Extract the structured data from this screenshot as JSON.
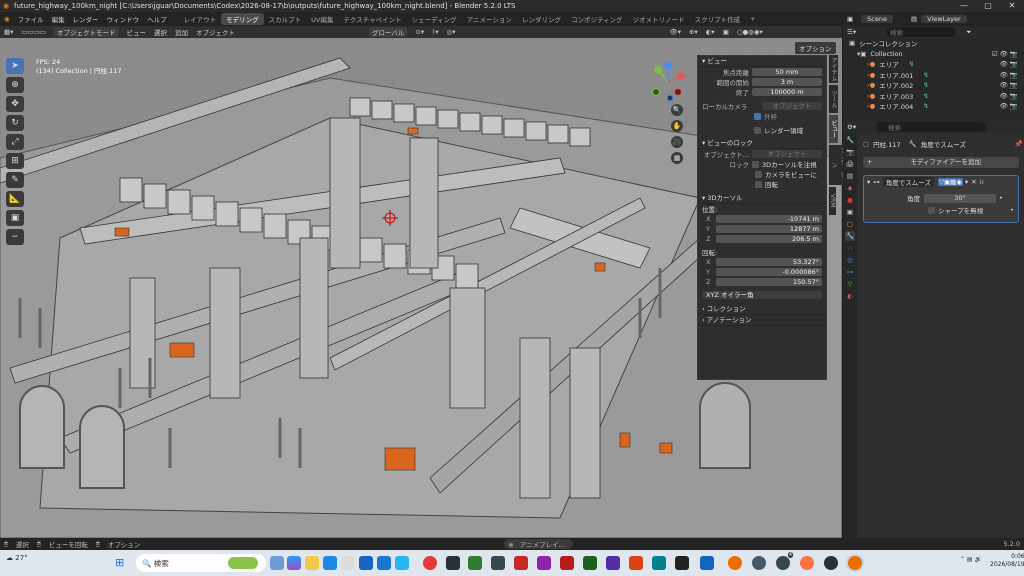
{
  "window": {
    "title": "future_highway_100km_night [C:\\Users\\jguar\\Documents\\Codex\\2026-08-17\\b\\outputs\\future_highway_100km_night.blend] - Blender 5.2.0 LTS"
  },
  "menu": {
    "items": [
      "ファイル",
      "編集",
      "レンダー",
      "ウィンドウ",
      "ヘルプ"
    ]
  },
  "workspaces": [
    "レイアウト",
    "モデリング",
    "スカルプト",
    "UV編集",
    "テクスチャペイント",
    "シェーディング",
    "アニメーション",
    "レンダリング",
    "コンポジティング",
    "ジオメトリノード",
    "スクリプト作成"
  ],
  "active_workspace": "モデリング",
  "scene": {
    "label": "Scene",
    "view_layer": "ViewLayer"
  },
  "viewport_header": {
    "mode": "オブジェクトモード",
    "menus": [
      "ビュー",
      "選択",
      "追加",
      "オブジェクト"
    ],
    "transform": "グローバル",
    "options": "オプション"
  },
  "stats": {
    "fps": "FPS: 24",
    "info": "(134) Collection | 円柱.117"
  },
  "npanel": {
    "view_title": "ビュー",
    "focal_label": "焦点距離",
    "focal_value": "50 mm",
    "clip_start_label": "範囲の開始",
    "clip_start_value": "3 m",
    "clip_end_label": "終了",
    "clip_end_value": "100000 m",
    "local_camera_label": "ローカルカメラ",
    "local_camera_placeholder": "オブジェクト",
    "outline_label": "外枠",
    "render_region_label": "レンダー領域",
    "view_lock_title": "ビューのロック",
    "lock_object_label": "オブジェクト...",
    "lock_object_placeholder": "オブジェクト",
    "lock_label": "ロック",
    "lock_cursor": "3Dカーソルを注視",
    "lock_camera": "カメラをビューに",
    "lock_rotation": "回転",
    "cursor_title": "3Dカーソル",
    "location_label": "位置:",
    "loc": [
      {
        "axis": "X",
        "value": "-10741 m"
      },
      {
        "axis": "Y",
        "value": "12877 m"
      },
      {
        "axis": "Z",
        "value": "206.5 m"
      }
    ],
    "rotation_label": "回転:",
    "rot": [
      {
        "axis": "X",
        "value": "53.327°"
      },
      {
        "axis": "Y",
        "value": "-0.000086°"
      },
      {
        "axis": "Z",
        "value": "150.57°"
      }
    ],
    "rotation_mode": "XYZ オイラー角",
    "collection_title": "コレクション",
    "annotation_title": "アノテーション",
    "tabs": [
      "アイテム",
      "ツール",
      "ビュー",
      "アノテーション",
      "VRM"
    ],
    "active_tab": "ビュー"
  },
  "outliner": {
    "title": "シーンコレクション",
    "collection": "Collection",
    "items": [
      "エリア",
      "エリア.001",
      "エリア.002",
      "エリア.003",
      "エリア.004"
    ],
    "search_placeholder": "検索"
  },
  "properties": {
    "search_placeholder": "検索",
    "object_name": "円柱.117",
    "modifier_name": "角度でスムーズ",
    "add_modifier": "モディファイアーを追加",
    "modifier_panel_name": "角度でスムーズ",
    "angle_label": "角度",
    "angle_value": "30°",
    "ignore_sharp": "シャープを無視"
  },
  "statusbar": {
    "select": "選択",
    "rotate_view": "ビューを回転",
    "options": "オプション",
    "center": "アニメプレイ...",
    "version": "5.2.0"
  },
  "taskbar": {
    "weather": "27°",
    "search_placeholder": "検索",
    "time": "0:06",
    "date": "2026/08/19",
    "badge": "4"
  },
  "colors": {
    "accent": "#4772b3",
    "viewport_bg": "#8a8a8a",
    "orange": "#d9651e",
    "panel": "#2e2e2e"
  }
}
